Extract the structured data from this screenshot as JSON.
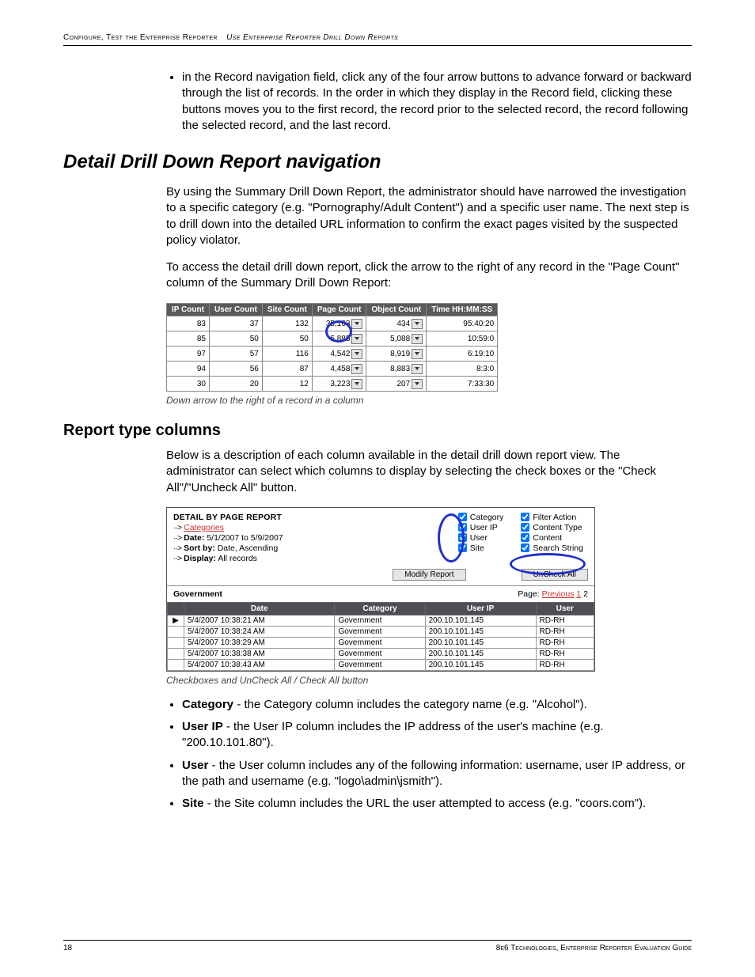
{
  "header": {
    "left": "Configure, Test the Enterprise Reporter",
    "right": "Use Enterprise Reporter Drill Down Reports"
  },
  "intro_bullet": "in the Record navigation field, click any of the four arrow buttons to advance forward or backward through the list of records. In the order in which they display in the Record field, clicking these buttons moves you to the first record, the record prior to the selected record, the record following the selected record, and the last record.",
  "h1": "Detail Drill Down Report navigation",
  "p1": "By using the Summary Drill Down Report, the administrator should have narrowed the investigation to a specific category (e.g. \"Pornography/Adult Content\") and a specific user name. The next step is to drill down into the detailed URL information to confirm the exact pages visited by the suspected policy violator.",
  "p2": "To access the detail drill down report, click the arrow to the right of any record in the \"Page Count\" column of the Summary Drill Down Report:",
  "countTable": {
    "headers": [
      "IP\nCount",
      "User\nCount",
      "Site\nCount",
      "Page\nCount",
      "Object\nCount",
      "Time\nHH:MM:SS"
    ],
    "rows": [
      {
        "ip": "83",
        "user": "37",
        "site": "132",
        "page": "35,163",
        "object": "434",
        "time": "95:40:20"
      },
      {
        "ip": "85",
        "user": "50",
        "site": "50",
        "page": "5,885",
        "object": "5,088",
        "time": "10:59:0"
      },
      {
        "ip": "97",
        "user": "57",
        "site": "116",
        "page": "4,542",
        "object": "8,919",
        "time": "6:19:10"
      },
      {
        "ip": "94",
        "user": "56",
        "site": "87",
        "page": "4,458",
        "object": "8,883",
        "time": "8:3:0"
      },
      {
        "ip": "30",
        "user": "20",
        "site": "12",
        "page": "3,223",
        "object": "207",
        "time": "7:33:30"
      }
    ]
  },
  "caption1": "Down arrow to the right of a record in a column",
  "h2": "Report type columns",
  "p3": "Below is a description of each column available in the detail drill down report view. The administrator can select which columns to display by selecting the check boxes or the \"Check All\"/\"Uncheck All\" button.",
  "detailPanel": {
    "title": "DETAIL BY PAGE REPORT",
    "lines": {
      "cats": "Categories",
      "date_label": "Date:",
      "date_value": "5/1/2007 to 5/9/2007",
      "sort_label": "Sort by:",
      "sort_value": "Date, Ascending",
      "display_label": "Display:",
      "display_value": "All records"
    },
    "checks_col1": [
      "Category",
      "User IP",
      "User",
      "Site"
    ],
    "checks_col2": [
      "Filter Action",
      "Content Type",
      "Content",
      "Search String"
    ],
    "buttons": {
      "modify": "Modify Report",
      "uncheck": "UnCheck All"
    },
    "current_cat": "Government",
    "pager": {
      "label": "Page:",
      "prev": "Previous",
      "p1": "1",
      "p2": "2"
    },
    "headers": [
      "",
      "Date",
      "Category",
      "User IP",
      "User"
    ],
    "rows": [
      {
        "mark": "▶",
        "date": "5/4/2007 10:38:21 AM",
        "cat": "Government",
        "ip": "200.10.101.145",
        "user": "RD-RH"
      },
      {
        "mark": "",
        "date": "5/4/2007 10:38:24 AM",
        "cat": "Government",
        "ip": "200.10.101.145",
        "user": "RD-RH"
      },
      {
        "mark": "",
        "date": "5/4/2007 10:38:29 AM",
        "cat": "Government",
        "ip": "200.10.101.145",
        "user": "RD-RH"
      },
      {
        "mark": "",
        "date": "5/4/2007 10:38:38 AM",
        "cat": "Government",
        "ip": "200.10.101.145",
        "user": "RD-RH"
      },
      {
        "mark": "",
        "date": "5/4/2007 10:38:43 AM",
        "cat": "Government",
        "ip": "200.10.101.145",
        "user": "RD-RH"
      }
    ]
  },
  "caption2": "Checkboxes and UnCheck All / Check All button",
  "defs": [
    {
      "term": "Category",
      "text": " - the Category column includes the category name (e.g. \"Alcohol\")."
    },
    {
      "term": "User IP",
      "text": " - the User IP column includes the IP address of the user's machine (e.g. \"200.10.101.80\")."
    },
    {
      "term": "User",
      "text": " - the User column includes any of the following information: username, user IP address, or the path and username (e.g. \"logo\\admin\\jsmith\")."
    },
    {
      "term": "Site",
      "text": " - the Site column includes the URL the user attempted to access (e.g. \"coors.com\")."
    }
  ],
  "footer": {
    "page": "18",
    "right": "8e6 Technologies, Enterprise Reporter Evaluation Guide"
  }
}
